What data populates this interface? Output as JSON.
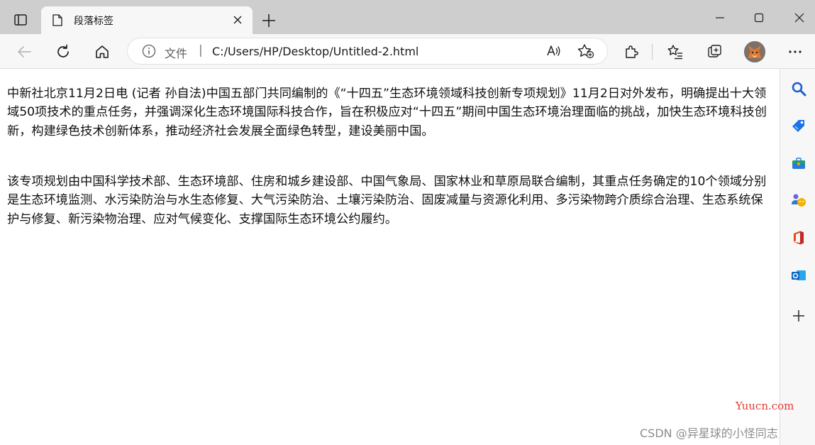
{
  "tab": {
    "title": "段落标签"
  },
  "address_bar": {
    "scheme_label": "文件",
    "separator": "|",
    "url": "C:/Users/HP/Desktop/Untitled-2.html"
  },
  "content": {
    "paragraphs": [
      "中新社北京11月2日电 (记者 孙自法)中国五部门共同编制的《“十四五”生态环境领域科技创新专项规划》11月2日对外发布，明确提出十大领域50项技术的重点任务，并强调深化生态环境国际科技合作，旨在积极应对“十四五”期间中国生态环境治理面临的挑战，加快生态环境科技创新，构建绿色技术创新体系，推动经济社会发展全面绿色转型，建设美丽中国。",
      "该专项规划由中国科学技术部、生态环境部、住房和城乡建设部、中国气象局、国家林业和草原局联合编制，其重点任务确定的10个领域分别是生态环境监测、水污染防治与水生态修复、大气污染防治、土壤污染防治、固废减量与资源化利用、多污染物跨介质综合治理、生态系统保护与修复、新污染物治理、应对气候变化、支撑国际生态环境公约履约。"
    ]
  },
  "watermarks": {
    "site": "Yuucn.com",
    "author": "CSDN @异星球的小怪同志"
  },
  "colors": {
    "tabstrip_bg": "#cecece",
    "toolbar_bg": "#f7f7f7",
    "text": "#111111",
    "watermark_red": "#e53935",
    "watermark_gray": "#8c8c8c"
  }
}
